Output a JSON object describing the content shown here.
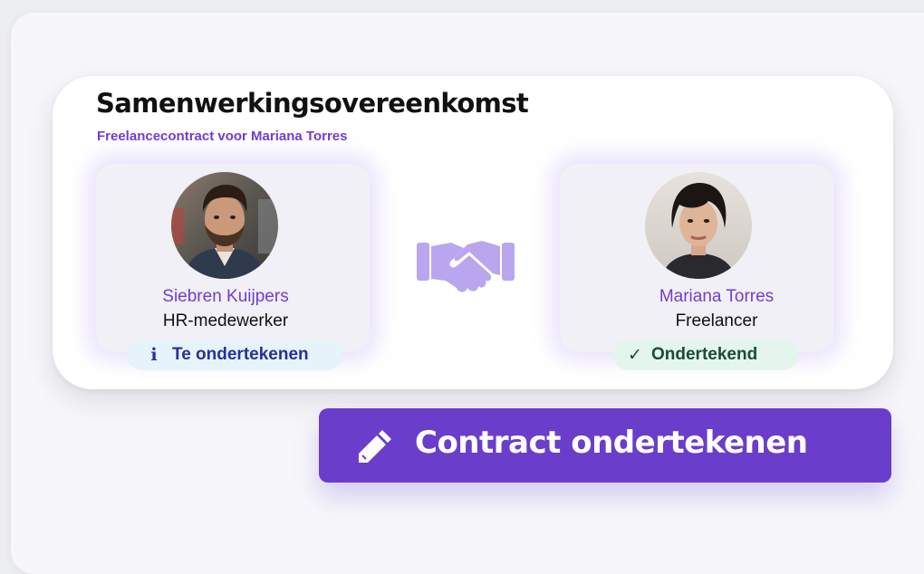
{
  "contract": {
    "title": "Samenwerkingsovereenkomst",
    "subtitle": "Freelancecontract voor Mariana Torres"
  },
  "parties": [
    {
      "name": "Siebren Kuijpers",
      "role": "HR-medewerker",
      "status_label": "Te ondertekenen",
      "status_icon": "info-icon",
      "status_icon_glyph": "i",
      "status": "pending"
    },
    {
      "name": "Mariana Torres",
      "role": "Freelancer",
      "status_label": "Ondertekend",
      "status_icon": "check-icon",
      "status_icon_glyph": "✓",
      "status": "signed"
    }
  ],
  "center_icon": "handshake-icon",
  "action": {
    "label": "Contract ondertekenen",
    "icon": "pencil-icon"
  },
  "colors": {
    "accent": "#6a3dca",
    "name_text": "#6d3fd1",
    "handshake": "#b9a6ee",
    "pending_bg": "#e6f3fa",
    "pending_text": "#26309c",
    "signed_bg": "#e3f5ec",
    "signed_text": "#1c4a38"
  }
}
